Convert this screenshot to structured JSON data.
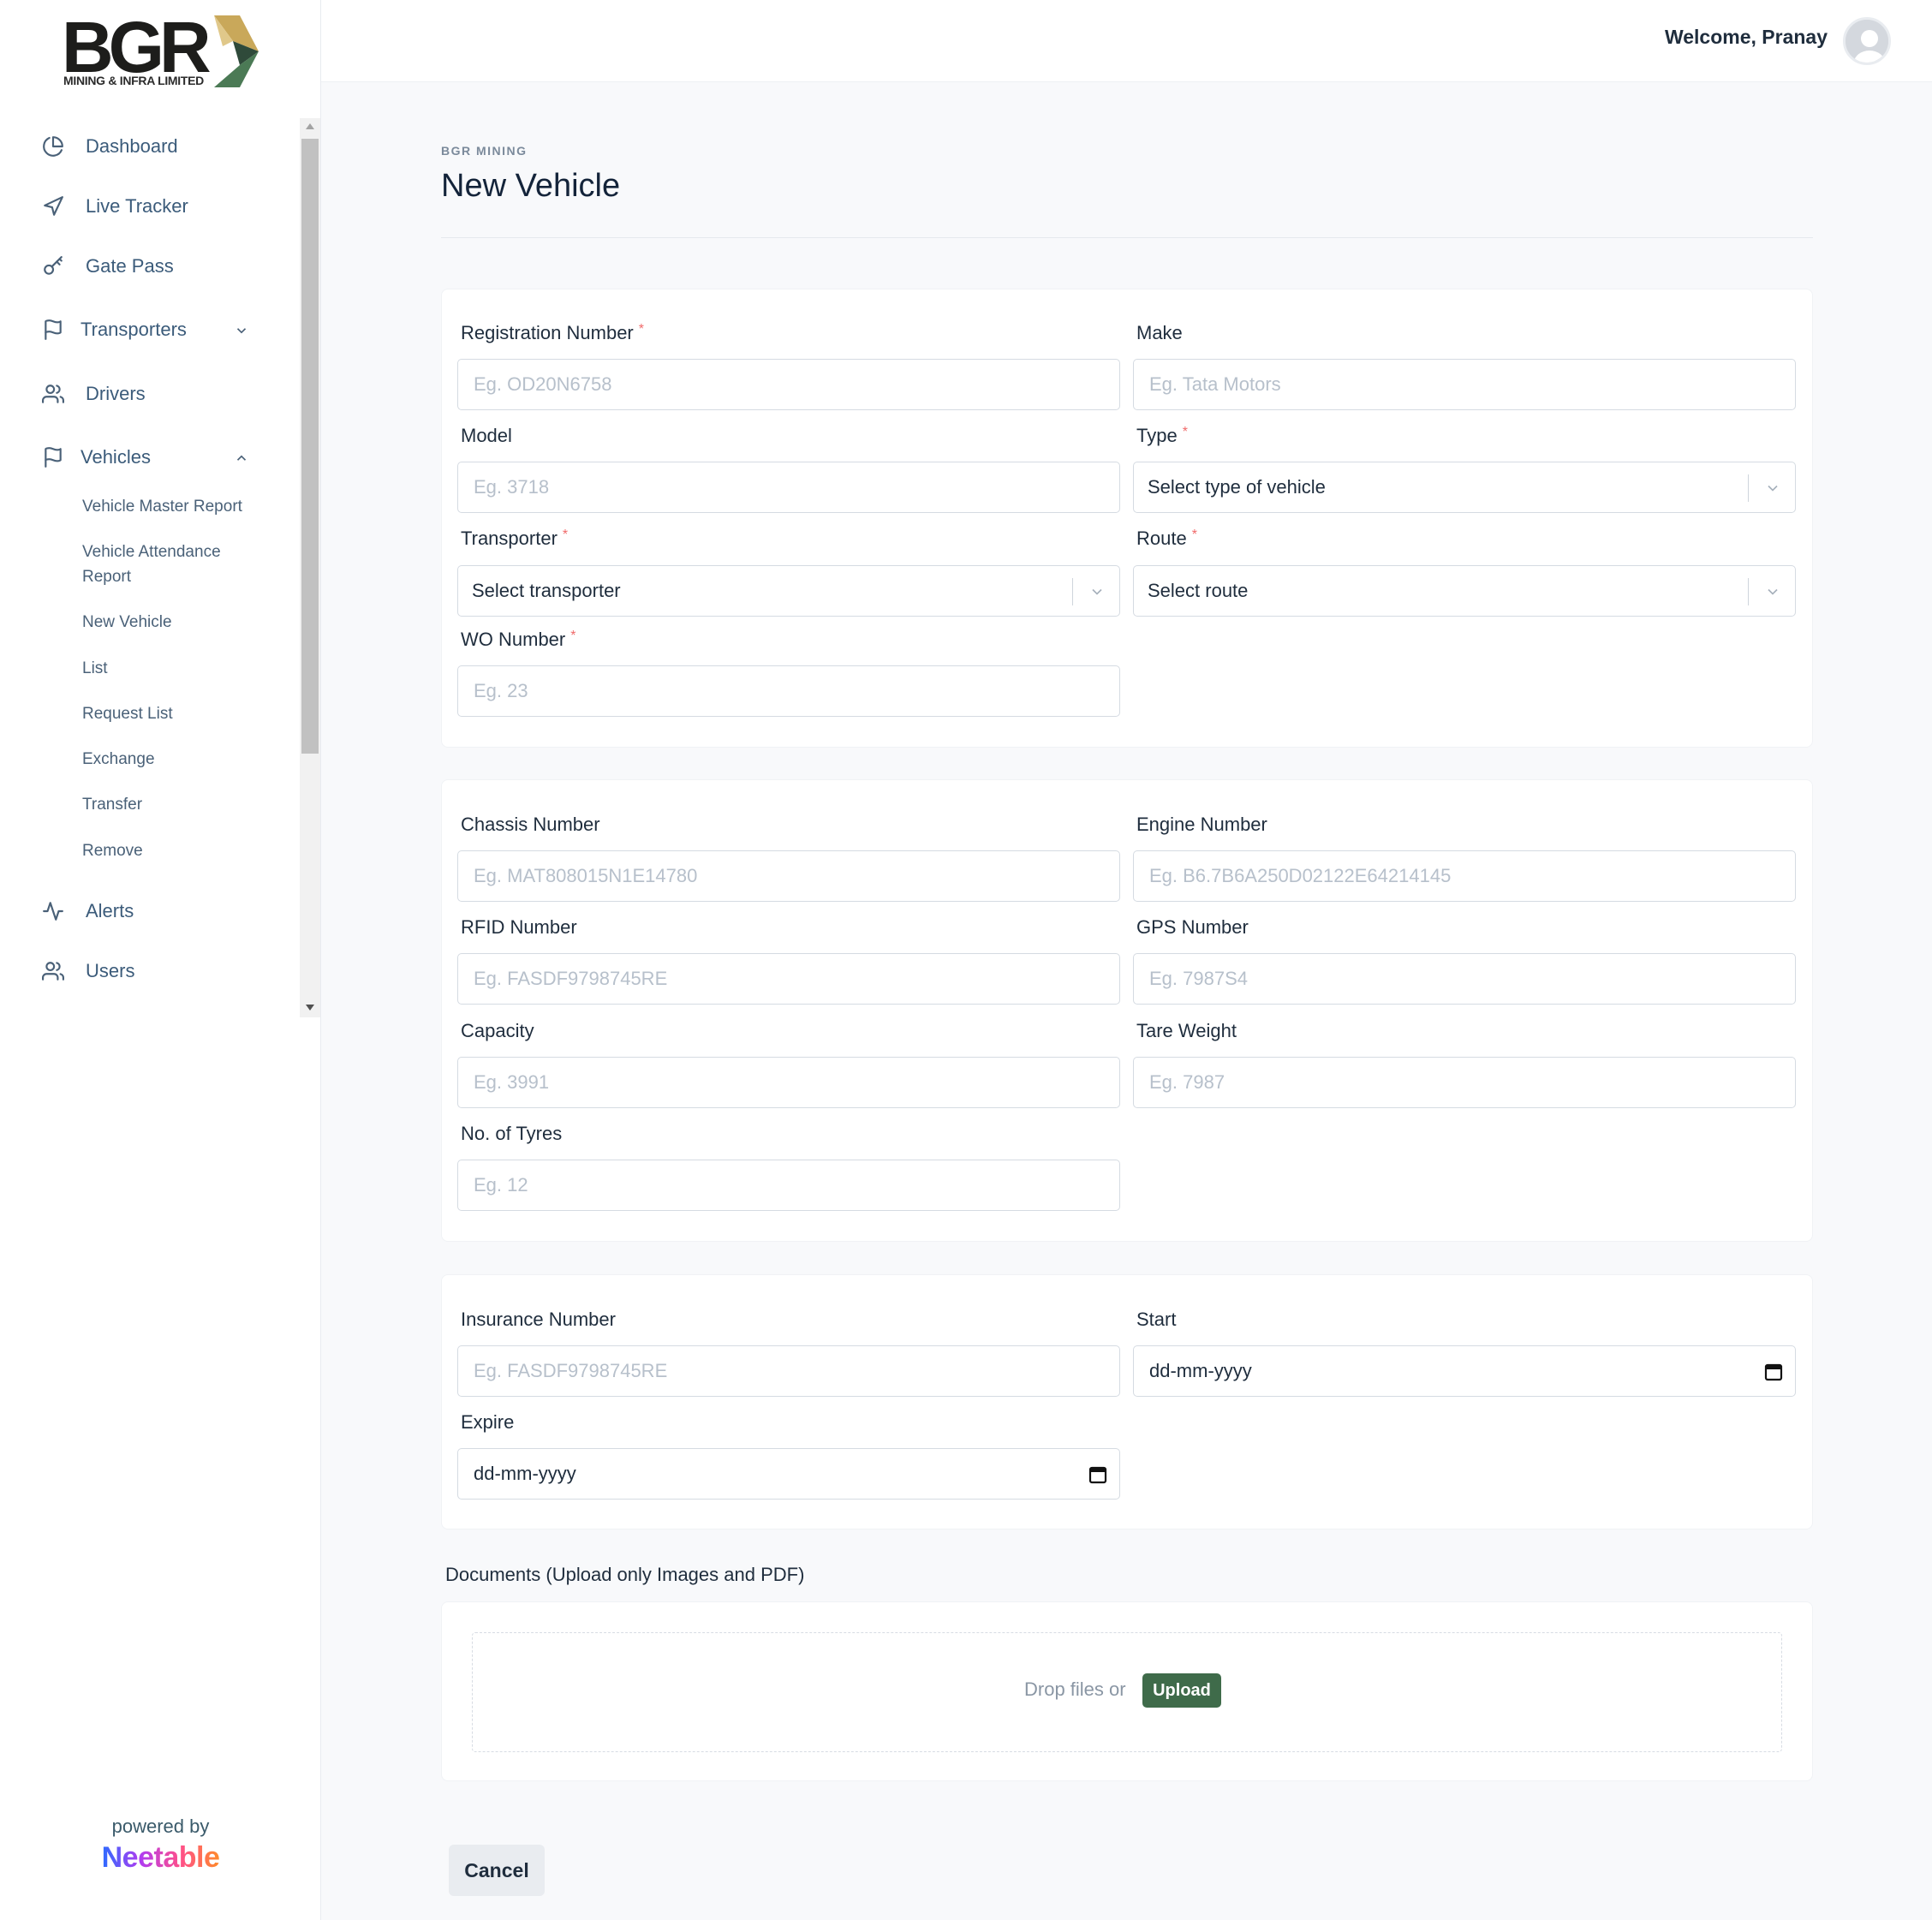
{
  "logo": {
    "main": "BGR",
    "sub": "MINING & INFRA LIMITED"
  },
  "header": {
    "welcome": "Welcome, Pranay"
  },
  "sidebar": {
    "items": [
      {
        "label": "Dashboard",
        "icon": "pie-chart-icon"
      },
      {
        "label": "Live Tracker",
        "icon": "navigation-icon"
      },
      {
        "label": "Gate Pass",
        "icon": "key-icon"
      },
      {
        "label": "Transporters",
        "icon": "flag-icon",
        "expanded": false
      },
      {
        "label": "Drivers",
        "icon": "users-icon"
      },
      {
        "label": "Vehicles",
        "icon": "flag-icon",
        "expanded": true
      },
      {
        "label": "Alerts",
        "icon": "activity-icon"
      },
      {
        "label": "Users",
        "icon": "users-icon"
      }
    ],
    "vehicles_sub": [
      "Vehicle Master Report",
      "Vehicle Attendance Report",
      "New Vehicle",
      "List",
      "Request List",
      "Exchange",
      "Transfer",
      "Remove"
    ],
    "powered_by": "powered by",
    "brand": "Neetable"
  },
  "page": {
    "breadcrumb": "BGR MINING",
    "title": "New Vehicle"
  },
  "form": {
    "registration": {
      "label": "Registration Number",
      "placeholder": "Eg. OD20N6758",
      "required": true
    },
    "make": {
      "label": "Make",
      "placeholder": "Eg. Tata Motors"
    },
    "model": {
      "label": "Model",
      "placeholder": "Eg. 3718"
    },
    "type": {
      "label": "Type",
      "value": "Select type of vehicle",
      "required": true
    },
    "transporter": {
      "label": "Transporter",
      "value": "Select transporter",
      "required": true
    },
    "route": {
      "label": "Route",
      "value": "Select route",
      "required": true
    },
    "wo": {
      "label": "WO Number",
      "placeholder": "Eg. 23",
      "required": true
    },
    "chassis": {
      "label": "Chassis Number",
      "placeholder": "Eg. MAT808015N1E14780"
    },
    "engine": {
      "label": "Engine Number",
      "placeholder": "Eg. B6.7B6A250D02122E64214145"
    },
    "rfid": {
      "label": "RFID Number",
      "placeholder": "Eg. FASDF9798745RE"
    },
    "gps": {
      "label": "GPS Number",
      "placeholder": "Eg. 7987S4"
    },
    "capacity": {
      "label": "Capacity",
      "placeholder": "Eg. 3991"
    },
    "tare": {
      "label": "Tare Weight",
      "placeholder": "Eg. 7987"
    },
    "tyres": {
      "label": "No. of Tyres",
      "placeholder": "Eg. 12"
    },
    "insurance": {
      "label": "Insurance Number",
      "placeholder": "Eg. FASDF9798745RE"
    },
    "start": {
      "label": "Start",
      "value": "dd-mm-yyyy"
    },
    "expire": {
      "label": "Expire",
      "value": "dd-mm-yyyy"
    },
    "documents": {
      "label": "Documents (Upload only Images and PDF)",
      "drop_text": "Drop files or",
      "upload_label": "Upload"
    },
    "cancel_label": "Cancel"
  },
  "colors": {
    "accent_green": "#3f6b4a",
    "required_red": "#f06a6a",
    "nav_text": "#3b5b7a"
  }
}
